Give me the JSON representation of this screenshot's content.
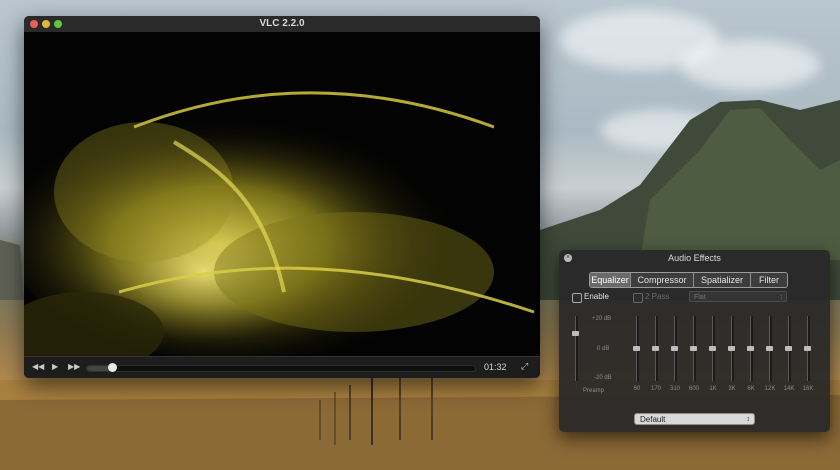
{
  "window": {
    "title": "VLC 2.2.0"
  },
  "playback": {
    "time": "01:32",
    "progress_fraction": 0.065
  },
  "controls": {
    "rewind_icon": "rewind-icon",
    "play_icon": "play-icon",
    "forward_icon": "fast-forward-icon",
    "fullscreen_icon": "fullscreen-icon"
  },
  "audio_effects": {
    "title": "Audio Effects",
    "tabs": [
      {
        "label": "Equalizer",
        "active": true
      },
      {
        "label": "Compressor",
        "active": false
      },
      {
        "label": "Spatializer",
        "active": false
      },
      {
        "label": "Filter",
        "active": false
      }
    ],
    "enable_label": "Enable",
    "two_pass_label": "2 Pass",
    "preset_value": "Flat",
    "db_labels": {
      "top": "+20 dB",
      "mid": "0 dB",
      "bottom": "-20 dB"
    },
    "preamp_label": "Preamp",
    "bands": [
      "60",
      "170",
      "310",
      "600",
      "1K",
      "3K",
      "6K",
      "12K",
      "14K",
      "16K"
    ],
    "profile_value": "Default"
  },
  "colors": {
    "panel_bg": "#282828",
    "active_tab": "#6a6a6a",
    "accent_yellow": "#e8e04a"
  }
}
